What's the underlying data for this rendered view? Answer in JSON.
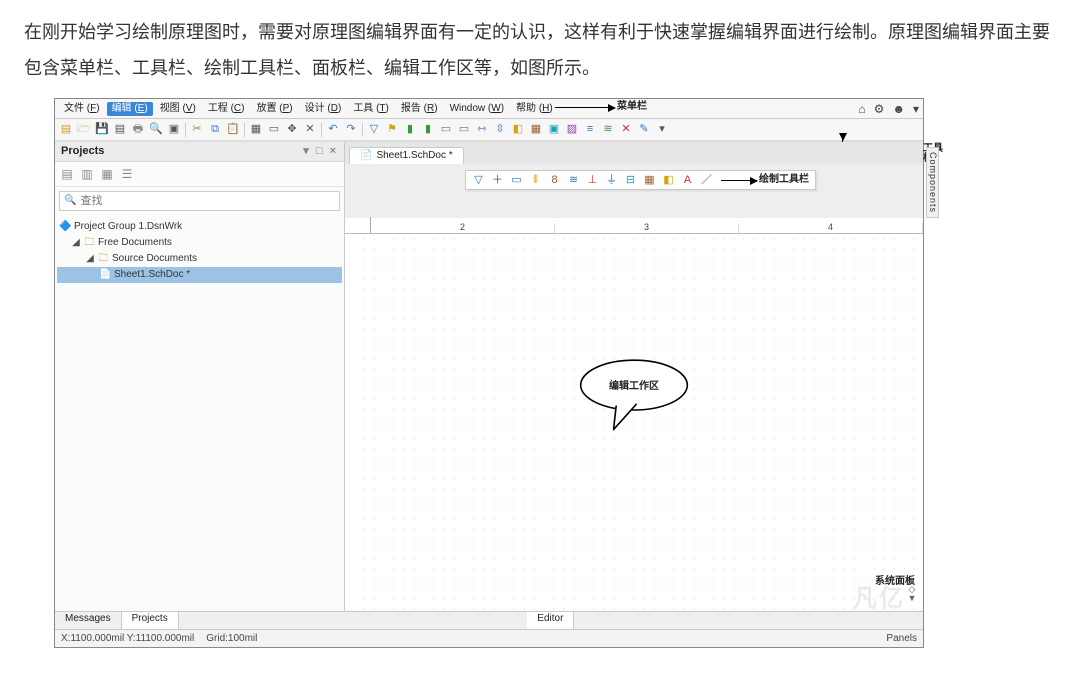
{
  "intro": "在刚开始学习绘制原理图时，需要对原理图编辑界面有一定的认识，这样有利于快速掌握编辑界面进行绘制。原理图编辑界面主要包含菜单栏、工具栏、绘制工具栏、面板栏、编辑工作区等，如图所示。",
  "callouts": {
    "menubar": "菜单栏",
    "toolbar": "工具栏",
    "panelbar": "面板栏",
    "draw_toolbar": "绘制工具栏",
    "edit_area": "编辑工作区",
    "system_panel": "系统面板"
  },
  "menubar": {
    "items": [
      {
        "label": "文件",
        "key": "F"
      },
      {
        "label": "编辑",
        "key": "E",
        "active": true
      },
      {
        "label": "视图",
        "key": "V"
      },
      {
        "label": "工程",
        "key": "C"
      },
      {
        "label": "放置",
        "key": "P"
      },
      {
        "label": "设计",
        "key": "D"
      },
      {
        "label": "工具",
        "key": "T"
      },
      {
        "label": "报告",
        "key": "R"
      },
      {
        "label": "Window",
        "key": "W"
      },
      {
        "label": "帮助",
        "key": "H"
      }
    ],
    "right_icons": [
      "home",
      "gear",
      "user"
    ]
  },
  "left_panel": {
    "title": "Projects",
    "search_placeholder": "查找",
    "tree": {
      "root": {
        "label": "Project Group 1.DsnWrk",
        "icon": "📦"
      },
      "n1": {
        "label": "Free Documents",
        "icon": "🗀"
      },
      "n2": {
        "label": "Source Documents",
        "icon": "🗀"
      },
      "n3": {
        "label": "Sheet1.SchDoc *",
        "icon": "📄"
      }
    }
  },
  "editor": {
    "tab_label": "Sheet1.SchDoc *",
    "ruler_marks": [
      "2",
      "3",
      "4"
    ]
  },
  "side_text": "Components",
  "bottom_tabs": {
    "messages": "Messages",
    "projects": "Projects",
    "editor": "Editor",
    "panels": "Panels"
  },
  "statusbar": {
    "pos": "X:1100.000mil Y:11100.000mil",
    "grid": "Grid:100mil"
  },
  "watermark": "凡亿"
}
